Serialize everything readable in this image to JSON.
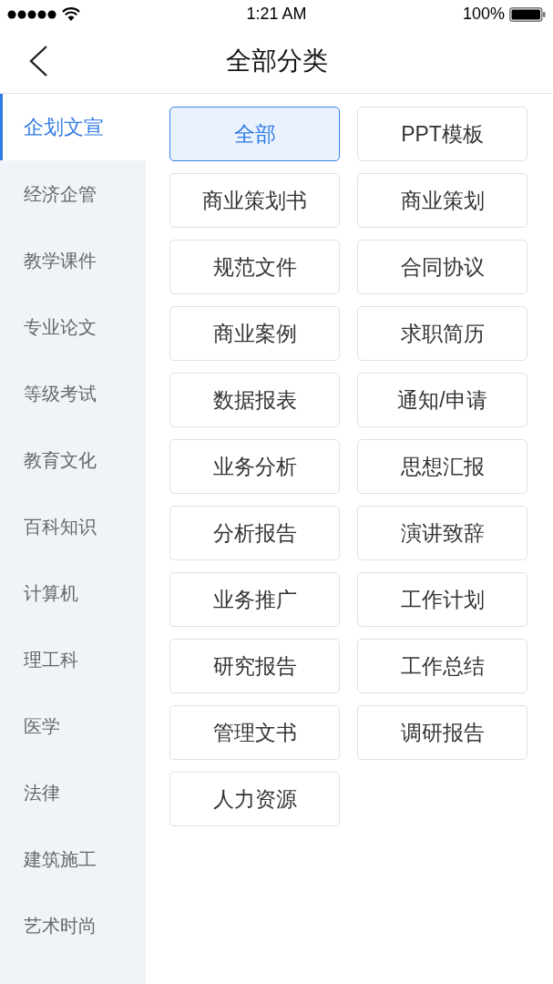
{
  "status_bar": {
    "time": "1:21 AM",
    "battery": "100%"
  },
  "header": {
    "title": "全部分类"
  },
  "sidebar": {
    "items": [
      {
        "label": "企划文宣",
        "selected": true
      },
      {
        "label": "经济企管",
        "selected": false
      },
      {
        "label": "教学课件",
        "selected": false
      },
      {
        "label": "专业论文",
        "selected": false
      },
      {
        "label": "等级考试",
        "selected": false
      },
      {
        "label": "教育文化",
        "selected": false
      },
      {
        "label": "百科知识",
        "selected": false
      },
      {
        "label": "计算机",
        "selected": false
      },
      {
        "label": "理工科",
        "selected": false
      },
      {
        "label": "医学",
        "selected": false
      },
      {
        "label": "法律",
        "selected": false
      },
      {
        "label": "建筑施工",
        "selected": false
      },
      {
        "label": "艺术时尚",
        "selected": false
      }
    ]
  },
  "categories": [
    {
      "label": "全部",
      "selected": true
    },
    {
      "label": "PPT模板",
      "selected": false
    },
    {
      "label": "商业策划书",
      "selected": false
    },
    {
      "label": "商业策划",
      "selected": false
    },
    {
      "label": "规范文件",
      "selected": false
    },
    {
      "label": "合同协议",
      "selected": false
    },
    {
      "label": "商业案例",
      "selected": false
    },
    {
      "label": "求职简历",
      "selected": false
    },
    {
      "label": "数据报表",
      "selected": false
    },
    {
      "label": "通知/申请",
      "selected": false
    },
    {
      "label": "业务分析",
      "selected": false
    },
    {
      "label": "思想汇报",
      "selected": false
    },
    {
      "label": "分析报告",
      "selected": false
    },
    {
      "label": "演讲致辞",
      "selected": false
    },
    {
      "label": "业务推广",
      "selected": false
    },
    {
      "label": "工作计划",
      "selected": false
    },
    {
      "label": "研究报告",
      "selected": false
    },
    {
      "label": "工作总结",
      "selected": false
    },
    {
      "label": "管理文书",
      "selected": false
    },
    {
      "label": "调研报告",
      "selected": false
    },
    {
      "label": "人力资源",
      "selected": false
    }
  ]
}
